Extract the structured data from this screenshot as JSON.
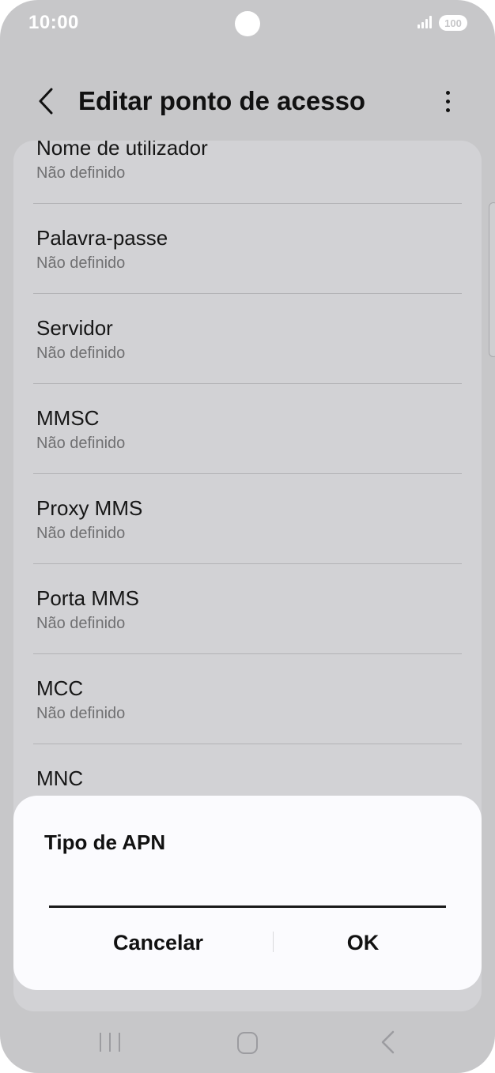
{
  "status_bar": {
    "time": "10:00",
    "battery": "100",
    "icons": [
      "camera-icon",
      "signal-icon",
      "battery-icon"
    ]
  },
  "header": {
    "title": "Editar ponto de acesso",
    "back_icon": "chevron-left-icon",
    "more_icon": "more-vertical-icon"
  },
  "list": {
    "items": [
      {
        "title": "Nome de utilizador",
        "value": "Não definido"
      },
      {
        "title": "Palavra-passe",
        "value": "Não definido"
      },
      {
        "title": "Servidor",
        "value": "Não definido"
      },
      {
        "title": "MMSC",
        "value": "Não definido"
      },
      {
        "title": "Proxy MMS",
        "value": "Não definido"
      },
      {
        "title": "Porta MMS",
        "value": "Não definido"
      },
      {
        "title": "MCC",
        "value": "Não definido"
      },
      {
        "title": "MNC",
        "value": ""
      }
    ]
  },
  "dialog": {
    "title": "Tipo de APN",
    "input_value": "",
    "cancel_label": "Cancelar",
    "ok_label": "OK"
  },
  "nav_bar": {
    "icons": [
      "recent-apps-icon",
      "home-icon",
      "back-icon"
    ]
  },
  "colors": {
    "screen_dim": "#c7c7c9",
    "list_card": "#d2d2d5",
    "dialog_bg": "#fbfbfe",
    "text_primary": "#161616",
    "text_secondary": "#707072"
  }
}
